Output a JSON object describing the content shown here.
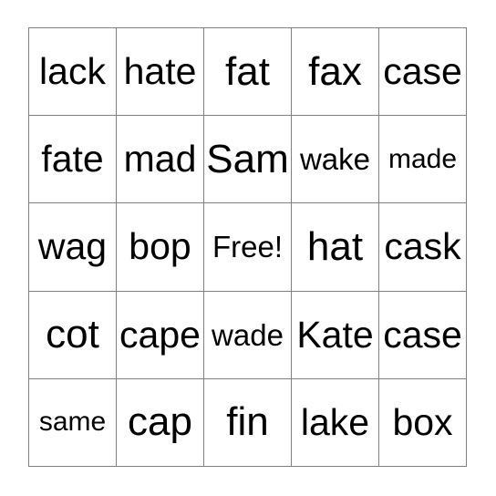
{
  "card": {
    "type": "bingo-card",
    "columns": 5,
    "rows": 5,
    "border_color": "#808080",
    "text_color": "#000000",
    "background_color": "#ffffff",
    "free_space": "Free!",
    "cells": [
      {
        "text": "lack",
        "size": "lg",
        "row": 1,
        "col": 1
      },
      {
        "text": "hate",
        "size": "lg",
        "row": 1,
        "col": 2
      },
      {
        "text": "fat",
        "size": "xl",
        "row": 1,
        "col": 3
      },
      {
        "text": "fax",
        "size": "xl",
        "row": 1,
        "col": 4
      },
      {
        "text": "case",
        "size": "lg",
        "row": 1,
        "col": 5
      },
      {
        "text": "fate",
        "size": "lg",
        "row": 2,
        "col": 1
      },
      {
        "text": "mad",
        "size": "lg",
        "row": 2,
        "col": 2
      },
      {
        "text": "Sam",
        "size": "xl",
        "row": 2,
        "col": 3
      },
      {
        "text": "wake",
        "size": "sm",
        "row": 2,
        "col": 4
      },
      {
        "text": "made",
        "size": "xs",
        "row": 2,
        "col": 5
      },
      {
        "text": "wag",
        "size": "lg",
        "row": 3,
        "col": 1
      },
      {
        "text": "bop",
        "size": "lg",
        "row": 3,
        "col": 2
      },
      {
        "text": "Free!",
        "size": "sm",
        "row": 3,
        "col": 3
      },
      {
        "text": "hat",
        "size": "xl",
        "row": 3,
        "col": 4
      },
      {
        "text": "cask",
        "size": "lg",
        "row": 3,
        "col": 5
      },
      {
        "text": "cot",
        "size": "xl",
        "row": 4,
        "col": 1
      },
      {
        "text": "cape",
        "size": "lg",
        "row": 4,
        "col": 2
      },
      {
        "text": "wade",
        "size": "sm",
        "row": 4,
        "col": 3
      },
      {
        "text": "Kate",
        "size": "lg",
        "row": 4,
        "col": 4
      },
      {
        "text": "case",
        "size": "lg",
        "row": 4,
        "col": 5
      },
      {
        "text": "same",
        "size": "xs",
        "row": 5,
        "col": 1
      },
      {
        "text": "cap",
        "size": "xl",
        "row": 5,
        "col": 2
      },
      {
        "text": "fin",
        "size": "xl",
        "row": 5,
        "col": 3
      },
      {
        "text": "lake",
        "size": "lg",
        "row": 5,
        "col": 4
      },
      {
        "text": "box",
        "size": "lg",
        "row": 5,
        "col": 5
      }
    ]
  }
}
